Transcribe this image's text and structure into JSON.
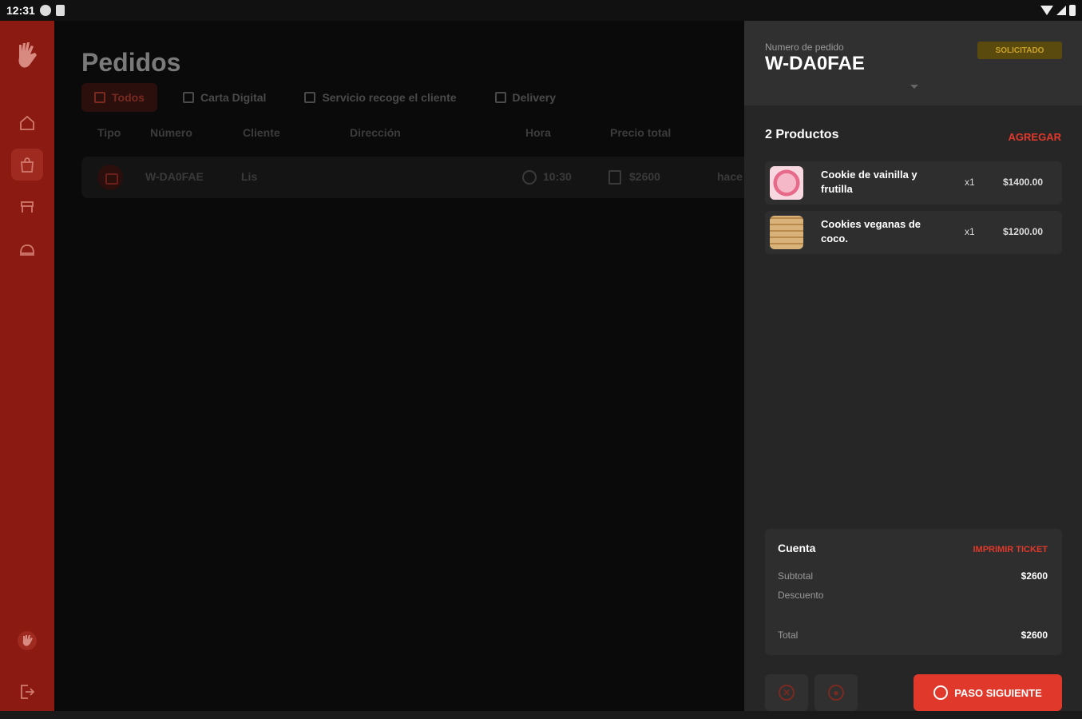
{
  "status_bar": {
    "time": "12:31"
  },
  "main": {
    "title": "Pedidos",
    "tabs": [
      {
        "label": "Todos"
      },
      {
        "label": "Carta Digital"
      },
      {
        "label": "Servicio recoge el cliente"
      },
      {
        "label": "Delivery"
      }
    ],
    "columns": [
      "Tipo",
      "Número",
      "Cliente",
      "Dirección",
      "Hora",
      "Precio total"
    ],
    "rows": [
      {
        "number": "W-DA0FAE",
        "client": "Lis",
        "time": "10:30",
        "total": "$2600",
        "extra": "hace"
      }
    ]
  },
  "panel": {
    "order_label": "Numero de pedido",
    "order_number": "W-DA0FAE",
    "status": "SOLICITADO",
    "products_count": "2 Productos",
    "add_label": "AGREGAR",
    "products": [
      {
        "name": "Cookie de vainilla y frutilla",
        "qty": "x1",
        "price": "$1400.00"
      },
      {
        "name": "Cookies veganas de coco.",
        "qty": "x1",
        "price": "$1200.00"
      }
    ],
    "account": {
      "title": "Cuenta",
      "print_label": "IMPRIMIR TICKET",
      "subtotal_label": "Subtotal",
      "subtotal": "$2600",
      "discount_label": "Descuento",
      "total_label": "Total",
      "total": "$2600"
    },
    "next_label": "PASO SIGUIENTE"
  },
  "colors": {
    "accent": "#e0392b",
    "sidebar": "#8a1a12",
    "badge": "#caa22a"
  }
}
